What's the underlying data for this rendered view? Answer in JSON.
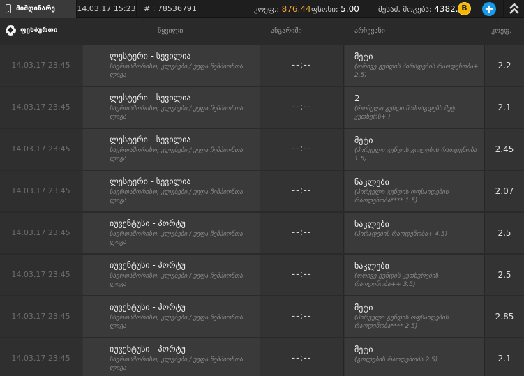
{
  "topbar": {
    "current_tab": "მიმდინარე",
    "date": "14.03.17 15:23",
    "ticket_label": "# : ",
    "ticket_id": "78536791",
    "odds_label": "კოეფ.: ",
    "odds_value": "876.44",
    "stake_label": "ფსონი: ",
    "stake_value": "5.00",
    "win_label": "შესაძ. მოგება: ",
    "win_value": "4382.20",
    "badge_letter": "B",
    "plus_symbol": "+",
    "colors": {
      "odds": "#f0a830",
      "badge": "#f5b800",
      "plus": "#1a9ae6"
    }
  },
  "header": {
    "sport": "ფეხბურთი",
    "col_event": "წყვილი",
    "col_score": "ანგარიში",
    "col_pick": "არჩევანი",
    "col_odd": "კოეფ."
  },
  "rows": [
    {
      "date": "14.03.17 23:45",
      "teams": "ლესტერი - სევილია",
      "league": "საერთაშორისო, კლუბები / უეფა ჩემპიონთა ლიგა",
      "score": "--:--",
      "pick": "მეტი",
      "desc": "(ორივე გუნდის პირადების რაოდენობა+ 2.5)",
      "odd": "2.2"
    },
    {
      "date": "14.03.17 23:45",
      "teams": "ლესტერი - სევილია",
      "league": "საერთაშორისო, კლუბები / უეფა ჩემპიონთა ლიგა",
      "score": "--:--",
      "pick": "2",
      "desc": "(რომელი გუნდი ჩამოაგდებს მეტ კუთხურს+ )",
      "odd": "2.1"
    },
    {
      "date": "14.03.17 23:45",
      "teams": "ლესტერი - სევილია",
      "league": "საერთაშორისო, კლუბები / უეფა ჩემპიონთა ლიგა",
      "score": "--:--",
      "pick": "მეტი",
      "desc": "(პირველი გუნდის გოლების რაოდენობა 1.5)",
      "odd": "2.45"
    },
    {
      "date": "14.03.17 23:45",
      "teams": "ლესტერი - სევილია",
      "league": "საერთაშორისო, კლუბები / უეფა ჩემპიონთა ლიგა",
      "score": "--:--",
      "pick": "ნაკლები",
      "desc": "(პირველი გუნდის ოფსაიდების რაოდენობა**** 1.5)",
      "odd": "2.07"
    },
    {
      "date": "14.03.17 23:45",
      "teams": "იუვენტუსი - პორტუ",
      "league": "საერთაშორისო, კლუბები / უეფა ჩემპიონთა ლიგა",
      "score": "--:--",
      "pick": "ნაკლები",
      "desc": "(პირადების რაოდენობა+ 4.5)",
      "odd": "2.5"
    },
    {
      "date": "14.03.17 23:45",
      "teams": "იუვენტუსი - პორტუ",
      "league": "საერთაშორისო, კლუბები / უეფა ჩემპიონთა ლიგა",
      "score": "--:--",
      "pick": "ნაკლები",
      "desc": "(ორივე გუნდის კუთხურების რაოდენობა++ 3.5)",
      "odd": "2.5"
    },
    {
      "date": "14.03.17 23:45",
      "teams": "იუვენტუსი - პორტუ",
      "league": "საერთაშორისო, კლუბები / უეფა ჩემპიონთა ლიგა",
      "score": "--:--",
      "pick": "მეტი",
      "desc": "(პირველი გუნდის ოფსაიდების რაოდენობა**** 2.5)",
      "odd": "2.85"
    },
    {
      "date": "14.03.17 23:45",
      "teams": "იუვენტუსი - პორტუ",
      "league": "საერთაშორისო, კლუბები / უეფა ჩემპიონთა ლიგა",
      "score": "--:--",
      "pick": "მეტი",
      "desc": "(გოლების რაოდენობა 2.5)",
      "odd": "2.1"
    }
  ]
}
